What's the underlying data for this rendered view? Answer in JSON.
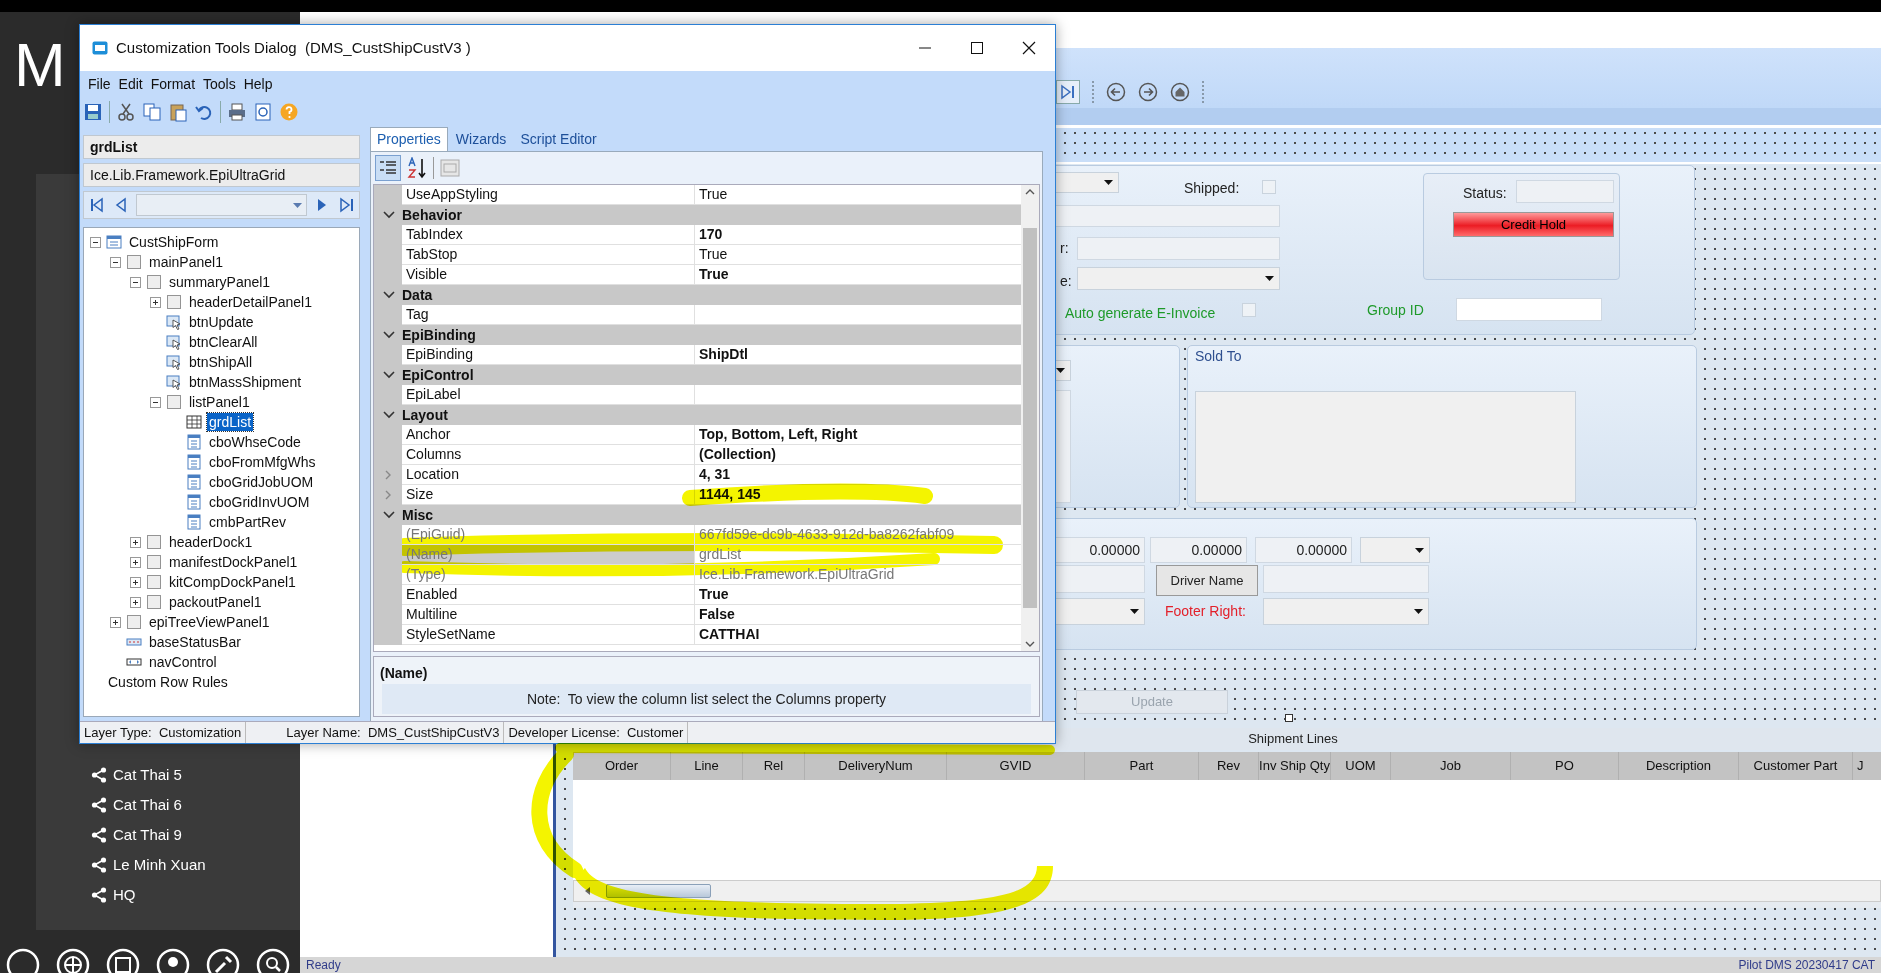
{
  "launcher": {
    "title": "M",
    "items": [
      {
        "label": "Cat Thai 5"
      },
      {
        "label": "Cat Thai 6"
      },
      {
        "label": "Cat Thai 9"
      },
      {
        "label": "Le Minh Xuan"
      },
      {
        "label": "HQ"
      }
    ]
  },
  "form": {
    "header": {
      "shipped_label": "Shipped:",
      "shipped_checked": false,
      "label_r": "r:",
      "label_e": "e:",
      "einvoice_label": "Auto generate E-Invoice",
      "einvoice_checked": false,
      "group_id_label": "Group ID",
      "status_label": "Status:",
      "credit_hold_button": "Credit Hold"
    },
    "sold_to": {
      "title": "Sold To"
    },
    "footer": {
      "amounts": [
        "0.00000",
        "0.00000",
        "0.00000"
      ],
      "driver_button": "Driver Name",
      "footer_right_label": "Footer Right:"
    },
    "update_button": {
      "label": "Update",
      "disabled": true
    },
    "shipment_lines": {
      "title": "Shipment Lines",
      "columns": [
        "Order",
        "Line",
        "Rel",
        "DeliveryNum",
        "GVID",
        "Part",
        "Rev",
        "Inv Ship Qty",
        "UOM",
        "Job",
        "PO",
        "Description",
        "Customer Part",
        "J"
      ]
    }
  },
  "status_bar": {
    "left": "Ready",
    "right": "Pilot DMS 20230417 CAT"
  },
  "dialog": {
    "title": "Customization Tools Dialog  (DMS_CustShipCustV3 )",
    "menu": [
      "File",
      "Edit",
      "Format",
      "Tools",
      "Help"
    ],
    "control_name": "grdList",
    "control_type": "Ice.Lib.Framework.EpiUltraGrid",
    "tree": [
      {
        "label": "CustShipForm",
        "kind": "form",
        "expanded": true,
        "selected": false,
        "children": [
          {
            "label": "mainPanel1",
            "kind": "panel",
            "expanded": true,
            "selected": false,
            "children": [
              {
                "label": "summaryPanel1",
                "kind": "panel",
                "expanded": true,
                "selected": false,
                "children": [
                  {
                    "label": "headerDetailPanel1",
                    "kind": "panel",
                    "expanded": false,
                    "selected": false
                  },
                  {
                    "label": "btnUpdate",
                    "kind": "button",
                    "selected": false
                  },
                  {
                    "label": "btnClearAll",
                    "kind": "button",
                    "selected": false
                  },
                  {
                    "label": "btnShipAll",
                    "kind": "button",
                    "selected": false
                  },
                  {
                    "label": "btnMassShipment",
                    "kind": "button",
                    "selected": false
                  },
                  {
                    "label": "listPanel1",
                    "kind": "panel",
                    "expanded": true,
                    "selected": false,
                    "children": [
                      {
                        "label": "grdList",
                        "kind": "grid",
                        "selected": true
                      },
                      {
                        "label": "cboWhseCode",
                        "kind": "combo",
                        "selected": false
                      },
                      {
                        "label": "cboFromMfgWhs",
                        "kind": "combo",
                        "selected": false
                      },
                      {
                        "label": "cboGridJobUOM",
                        "kind": "combo",
                        "selected": false
                      },
                      {
                        "label": "cboGridInvUOM",
                        "kind": "combo",
                        "selected": false
                      },
                      {
                        "label": "cmbPartRev",
                        "kind": "combo",
                        "selected": false
                      }
                    ]
                  }
                ]
              },
              {
                "label": "headerDock1",
                "kind": "panel",
                "expanded": false,
                "selected": false
              },
              {
                "label": "manifestDockPanel1",
                "kind": "panel",
                "expanded": false,
                "selected": false
              },
              {
                "label": "kitCompDockPanel1",
                "kind": "panel",
                "expanded": false,
                "selected": false
              },
              {
                "label": "packoutPanel1",
                "kind": "panel",
                "expanded": false,
                "selected": false
              }
            ]
          },
          {
            "label": "epiTreeViewPanel1",
            "kind": "panel",
            "expanded": false,
            "selected": false
          },
          {
            "label": "baseStatusBar",
            "kind": "statusbar",
            "selected": false
          },
          {
            "label": "navControl",
            "kind": "nav",
            "selected": false
          }
        ]
      },
      {
        "label": "Custom Row Rules",
        "kind": "rules",
        "selected": false
      }
    ],
    "tabs": [
      {
        "label": "Properties",
        "selected": true
      },
      {
        "label": "Wizards",
        "selected": false
      },
      {
        "label": "Script Editor",
        "selected": false
      }
    ],
    "properties": [
      {
        "kind": "property",
        "name": "UseAppStyling",
        "value": "True",
        "bold": false,
        "readonly": false,
        "selected": false
      },
      {
        "kind": "category",
        "name": "Behavior",
        "expanded": true
      },
      {
        "kind": "property",
        "name": "TabIndex",
        "value": "170",
        "bold": true,
        "readonly": false,
        "selected": false
      },
      {
        "kind": "property",
        "name": "TabStop",
        "value": "True",
        "bold": false,
        "readonly": false,
        "selected": false
      },
      {
        "kind": "property",
        "name": "Visible",
        "value": "True",
        "bold": true,
        "readonly": false,
        "selected": false
      },
      {
        "kind": "category",
        "name": "Data",
        "expanded": true
      },
      {
        "kind": "property",
        "name": "Tag",
        "readonly": false,
        "selected": false
      },
      {
        "kind": "category",
        "name": "EpiBinding",
        "expanded": true
      },
      {
        "kind": "property",
        "name": "EpiBinding",
        "value": "ShipDtl",
        "bold": true,
        "readonly": false,
        "selected": false
      },
      {
        "kind": "category",
        "name": "EpiControl",
        "expanded": true
      },
      {
        "kind": "property",
        "name": "EpiLabel",
        "readonly": false,
        "selected": false
      },
      {
        "kind": "category",
        "name": "Layout",
        "expanded": true
      },
      {
        "kind": "property",
        "name": "Anchor",
        "value": "Top, Bottom, Left, Right",
        "bold": true,
        "readonly": false,
        "selected": false
      },
      {
        "kind": "property",
        "name": "Columns",
        "value": "(Collection)",
        "bold": true,
        "readonly": false,
        "selected": false
      },
      {
        "kind": "property",
        "name": "Location",
        "value": "4, 31",
        "bold": true,
        "readonly": false,
        "selected": false,
        "expanded": false
      },
      {
        "kind": "property",
        "name": "Size",
        "value": "1144, 145",
        "bold": true,
        "readonly": false,
        "selected": false,
        "expanded": false
      },
      {
        "kind": "category",
        "name": "Misc",
        "expanded": true
      },
      {
        "kind": "property",
        "name": "(EpiGuid)",
        "value": "667fd59e-dc9b-4633-912d-ba8262fabf09",
        "bold": false,
        "readonly": true,
        "selected": false
      },
      {
        "kind": "property",
        "name": "(Name)",
        "value": "grdList",
        "bold": false,
        "readonly": true,
        "selected": true
      },
      {
        "kind": "property",
        "name": "(Type)",
        "value": "Ice.Lib.Framework.EpiUltraGrid",
        "bold": false,
        "readonly": true,
        "selected": false
      },
      {
        "kind": "property",
        "name": "Enabled",
        "value": "True",
        "bold": true,
        "readonly": false,
        "selected": false
      },
      {
        "kind": "property",
        "name": "Multiline",
        "value": "False",
        "bold": true,
        "readonly": false,
        "selected": false
      },
      {
        "kind": "property",
        "name": "StyleSetName",
        "value": "CATTHAI",
        "bold": true,
        "readonly": false,
        "selected": false
      }
    ],
    "description_title": "(Name)",
    "note": "Note:  To view the column list select the Columns property",
    "status": [
      "Layer Type:  Customization",
      "Layer Name:  DMS_CustShipCustV3",
      "Developer License:  Customer"
    ]
  }
}
